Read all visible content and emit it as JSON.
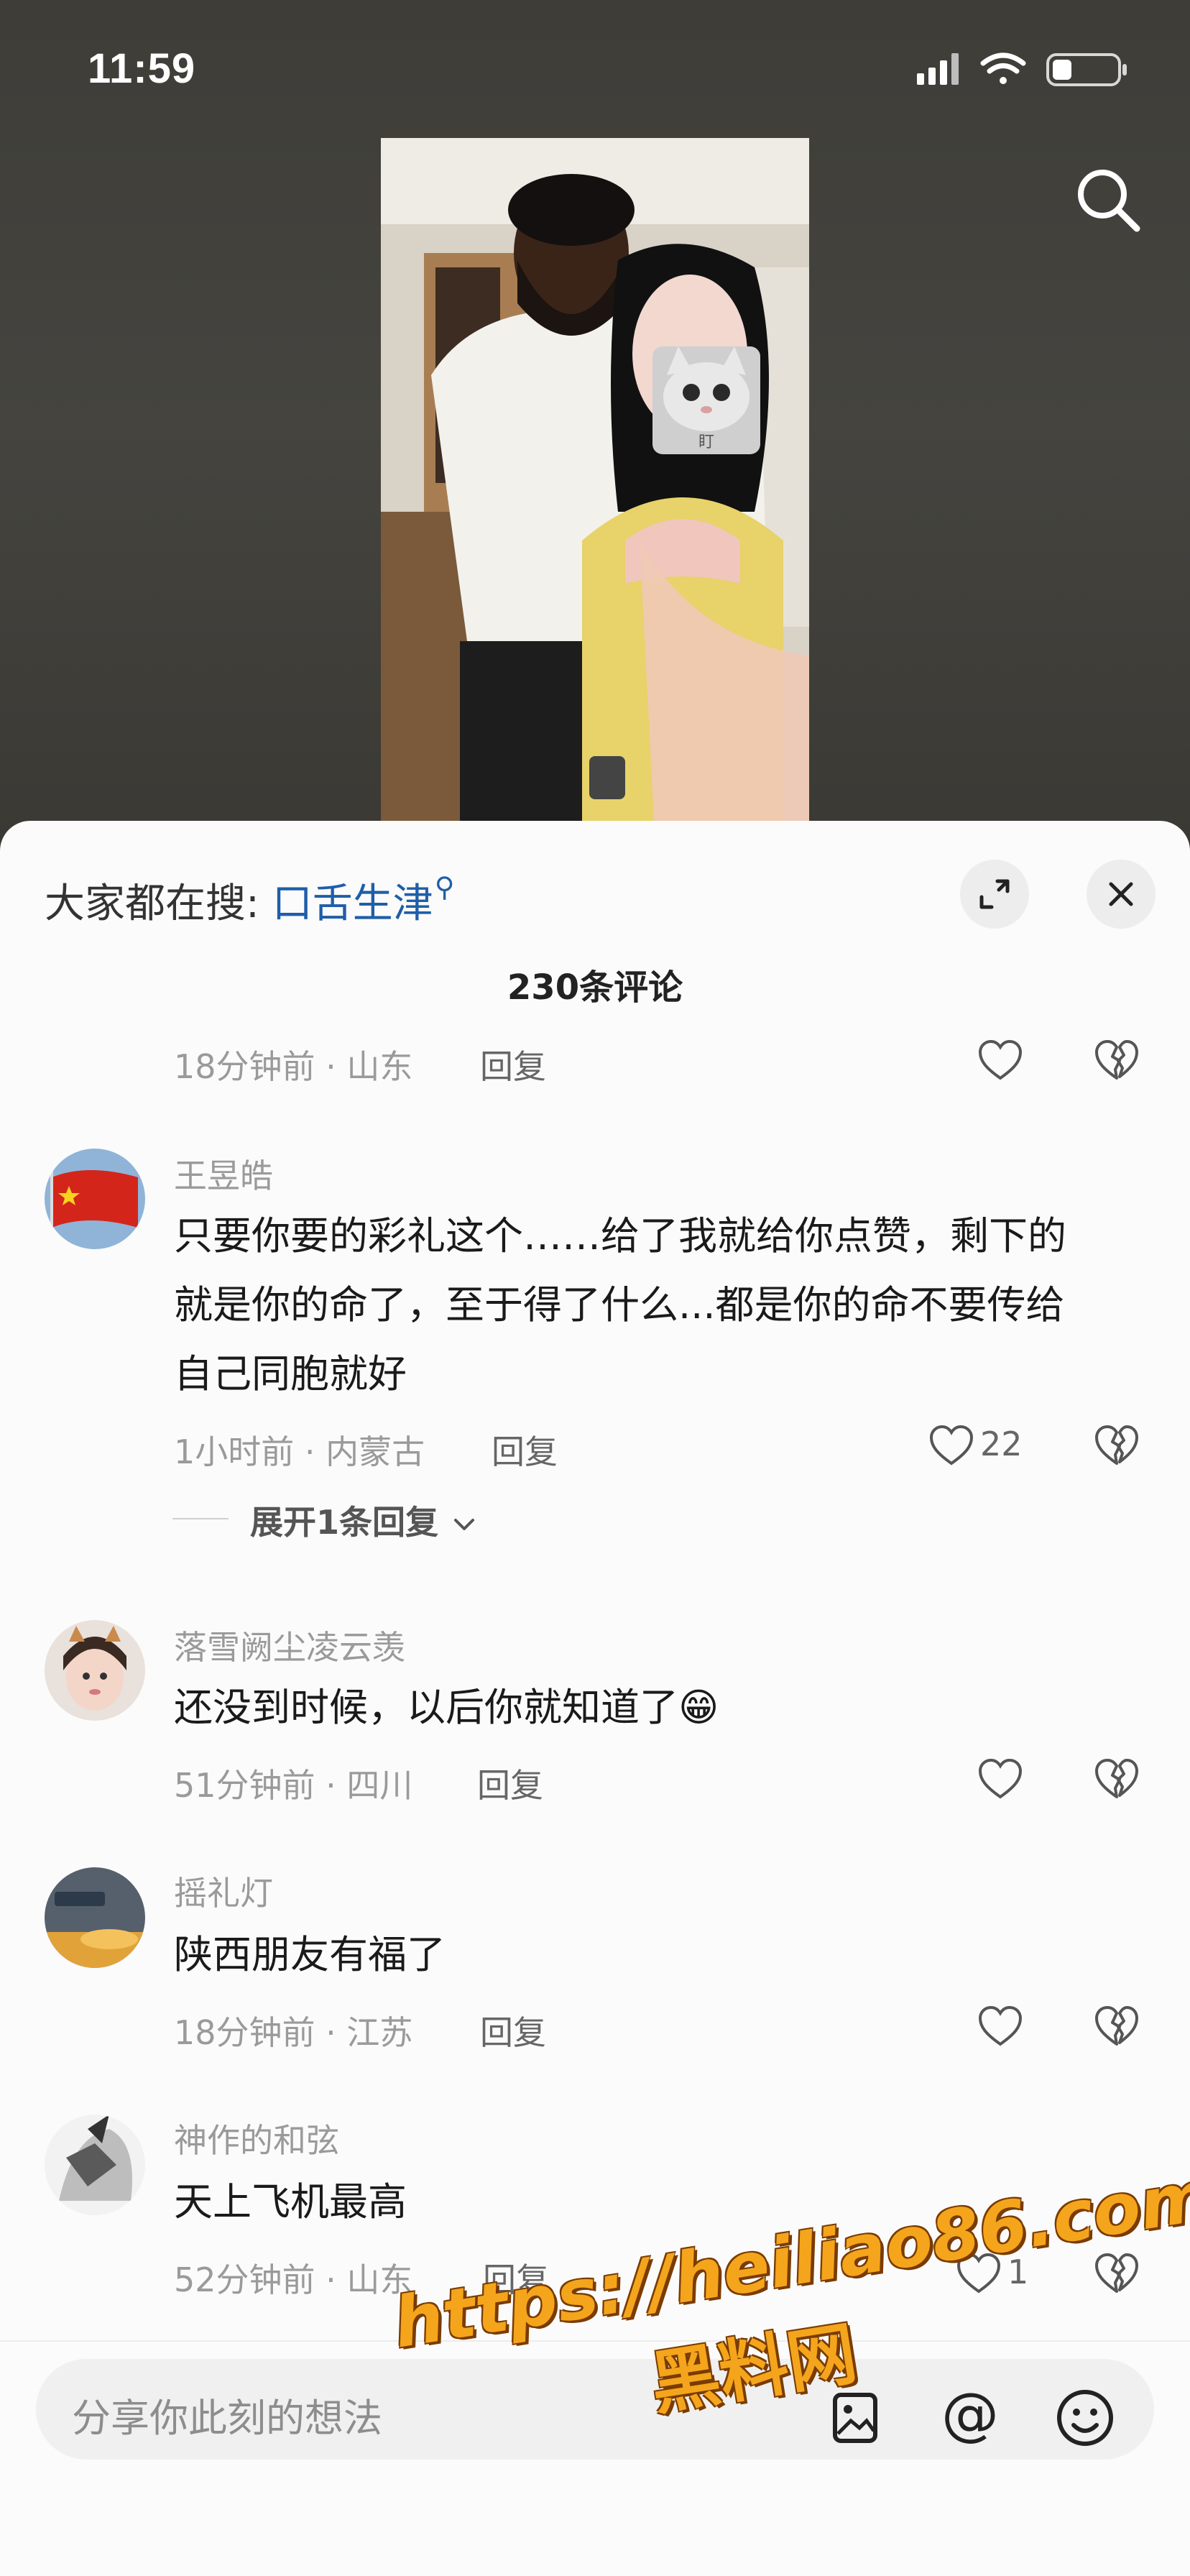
{
  "status_bar": {
    "time": "11:59"
  },
  "search_hint": {
    "prefix": "大家都在搜:",
    "term": "口舌生津"
  },
  "comments_header": {
    "count_label": "230条评论"
  },
  "partial_comment": {
    "meta": "18分钟前 · 山东",
    "reply": "回复"
  },
  "comments": [
    {
      "author": "王昱皓",
      "text_lines": [
        "只要你要的彩礼这个……给了我就给你点赞，剩下的",
        "就是你的命了，至于得了什么...都是你的命不要传给",
        "自己同胞就好"
      ],
      "meta": "1小时前 · 内蒙古",
      "reply": "回复",
      "likes": "22",
      "expand_label": "展开1条回复"
    },
    {
      "author": "落雪阙尘凌云羡",
      "text_lines": [
        "还没到时候，以后你就知道了😁"
      ],
      "meta": "51分钟前 · 四川",
      "reply": "回复",
      "likes": ""
    },
    {
      "author": "摇礼灯",
      "text_lines": [
        "陕西朋友有福了"
      ],
      "meta": "18分钟前 · 江苏",
      "reply": "回复",
      "likes": ""
    },
    {
      "author": "神作的和弦",
      "text_lines": [
        "天上飞机最高"
      ],
      "meta": "52分钟前 · 山东",
      "reply": "回复",
      "likes": "1"
    }
  ],
  "input": {
    "placeholder": "分享你此刻的想法"
  },
  "watermark": {
    "url": "https://heiliao86.com",
    "name": "黑料网"
  },
  "photo": {
    "sticker_text": "盯"
  },
  "colors": {
    "link_blue": "#1f5ea8",
    "sheet_bg": "#fbfbfb",
    "watermark_orange": "#f4a51c"
  },
  "icons": [
    "wifi-icon",
    "signal-icon",
    "battery-icon",
    "search-icon",
    "expand-icon",
    "close-icon",
    "heart-icon",
    "broken-heart-icon",
    "image-icon",
    "at-icon",
    "emoji-icon",
    "chevron-down-icon"
  ]
}
